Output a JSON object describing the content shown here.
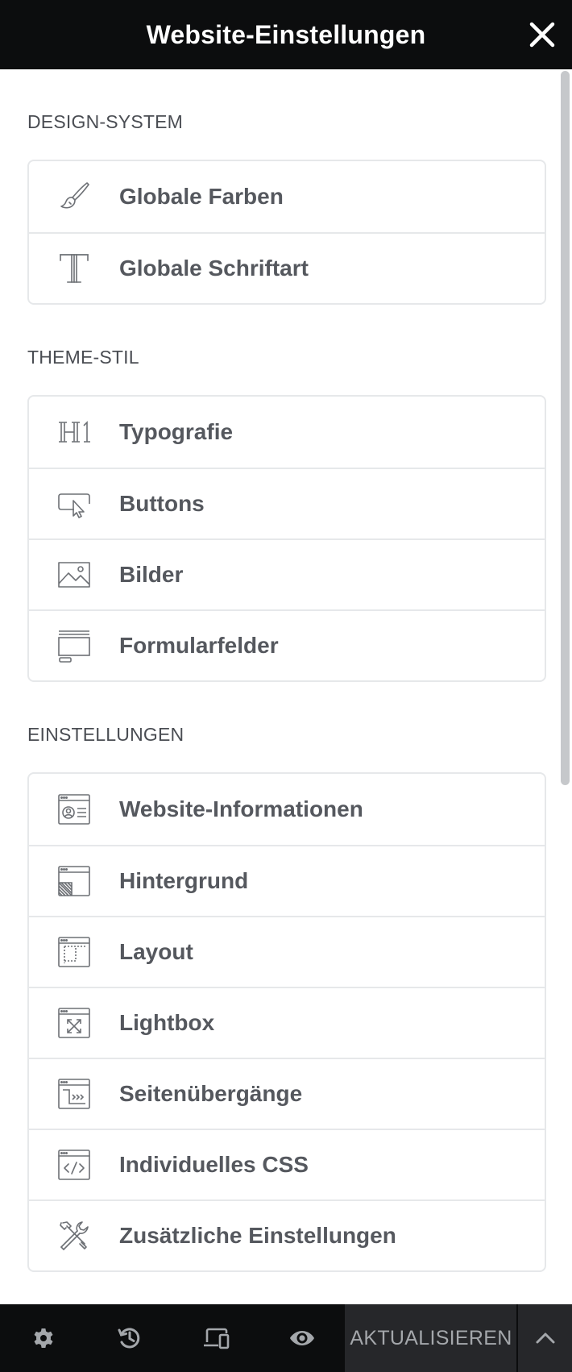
{
  "header": {
    "title": "Website-Einstellungen",
    "close_icon": "close-icon"
  },
  "sections": [
    {
      "title": "DESIGN-SYSTEM",
      "items": [
        {
          "label": "Globale Farben",
          "icon": "brush-icon"
        },
        {
          "label": "Globale Schriftart",
          "icon": "typeface-icon"
        }
      ]
    },
    {
      "title": "THEME-STIL",
      "items": [
        {
          "label": "Typografie",
          "icon": "heading-h1-icon"
        },
        {
          "label": "Buttons",
          "icon": "button-cursor-icon"
        },
        {
          "label": "Bilder",
          "icon": "image-icon"
        },
        {
          "label": "Formularfelder",
          "icon": "form-fields-icon"
        }
      ]
    },
    {
      "title": "EINSTELLUNGEN",
      "items": [
        {
          "label": "Website-Informationen",
          "icon": "site-identity-icon"
        },
        {
          "label": "Hintergrund",
          "icon": "background-icon"
        },
        {
          "label": "Layout",
          "icon": "layout-icon"
        },
        {
          "label": "Lightbox",
          "icon": "lightbox-icon"
        },
        {
          "label": "Seitenübergänge",
          "icon": "page-transitions-icon"
        },
        {
          "label": "Individuelles CSS",
          "icon": "custom-css-icon"
        },
        {
          "label": "Zusätzliche Einstellungen",
          "icon": "tools-icon"
        }
      ]
    }
  ],
  "footer": {
    "settings_icon": "gear-icon",
    "history_icon": "history-icon",
    "responsive_icon": "responsive-devices-icon",
    "preview_icon": "eye-icon",
    "update_label": "AKTUALISIEREN",
    "expand_icon": "chevron-up-icon"
  },
  "colors": {
    "header_bg": "#0c0d0e",
    "label_text": "#55585e",
    "section_text": "#4a4d53",
    "border": "#e6e8ea",
    "update_bg": "#26272a",
    "update_text": "#a4a7ab"
  }
}
